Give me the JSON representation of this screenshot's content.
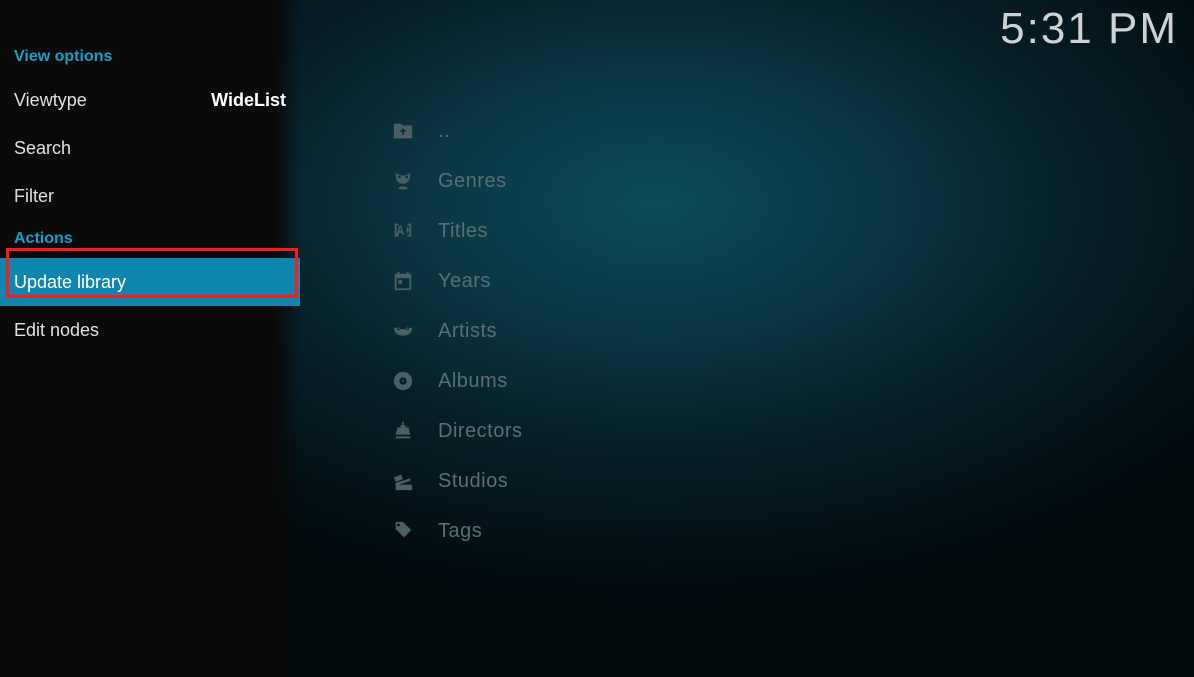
{
  "clock": "5:31 PM",
  "sidebar": {
    "view_options_header": "View options",
    "viewtype_label": "Viewtype",
    "viewtype_value": "WideList",
    "search_label": "Search",
    "filter_label": "Filter",
    "actions_header": "Actions",
    "update_library_label": "Update library",
    "edit_nodes_label": "Edit nodes"
  },
  "main": {
    "items": [
      {
        "label": ".."
      },
      {
        "label": "Genres"
      },
      {
        "label": "Titles"
      },
      {
        "label": "Years"
      },
      {
        "label": "Artists"
      },
      {
        "label": "Albums"
      },
      {
        "label": "Directors"
      },
      {
        "label": "Studios"
      },
      {
        "label": "Tags"
      }
    ]
  }
}
